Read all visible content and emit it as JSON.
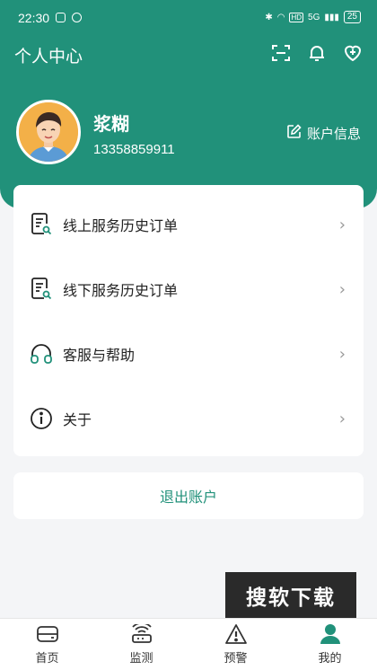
{
  "status_bar": {
    "time": "22:30",
    "network": "5G",
    "battery": "25"
  },
  "header": {
    "title": "个人中心",
    "icons": [
      "scan-icon",
      "bell-icon",
      "heart-plus-icon"
    ]
  },
  "profile": {
    "name": "浆糊",
    "phone": "13358859911",
    "account_info_label": "账户信息"
  },
  "menu": {
    "items": [
      {
        "label": "线上服务历史订单",
        "icon": "document-search-icon"
      },
      {
        "label": "线下服务历史订单",
        "icon": "document-search-icon"
      },
      {
        "label": "客服与帮助",
        "icon": "headset-icon"
      },
      {
        "label": "关于",
        "icon": "info-icon"
      }
    ]
  },
  "logout_label": "退出账户",
  "watermark": "搜软下载",
  "tabbar": {
    "tabs": [
      {
        "label": "首页",
        "icon": "home-icon"
      },
      {
        "label": "监测",
        "icon": "monitor-icon"
      },
      {
        "label": "预警",
        "icon": "warning-icon"
      },
      {
        "label": "我的",
        "icon": "user-icon",
        "active": true
      }
    ]
  },
  "colors": {
    "primary": "#21917a",
    "background": "#f4f5f7"
  }
}
